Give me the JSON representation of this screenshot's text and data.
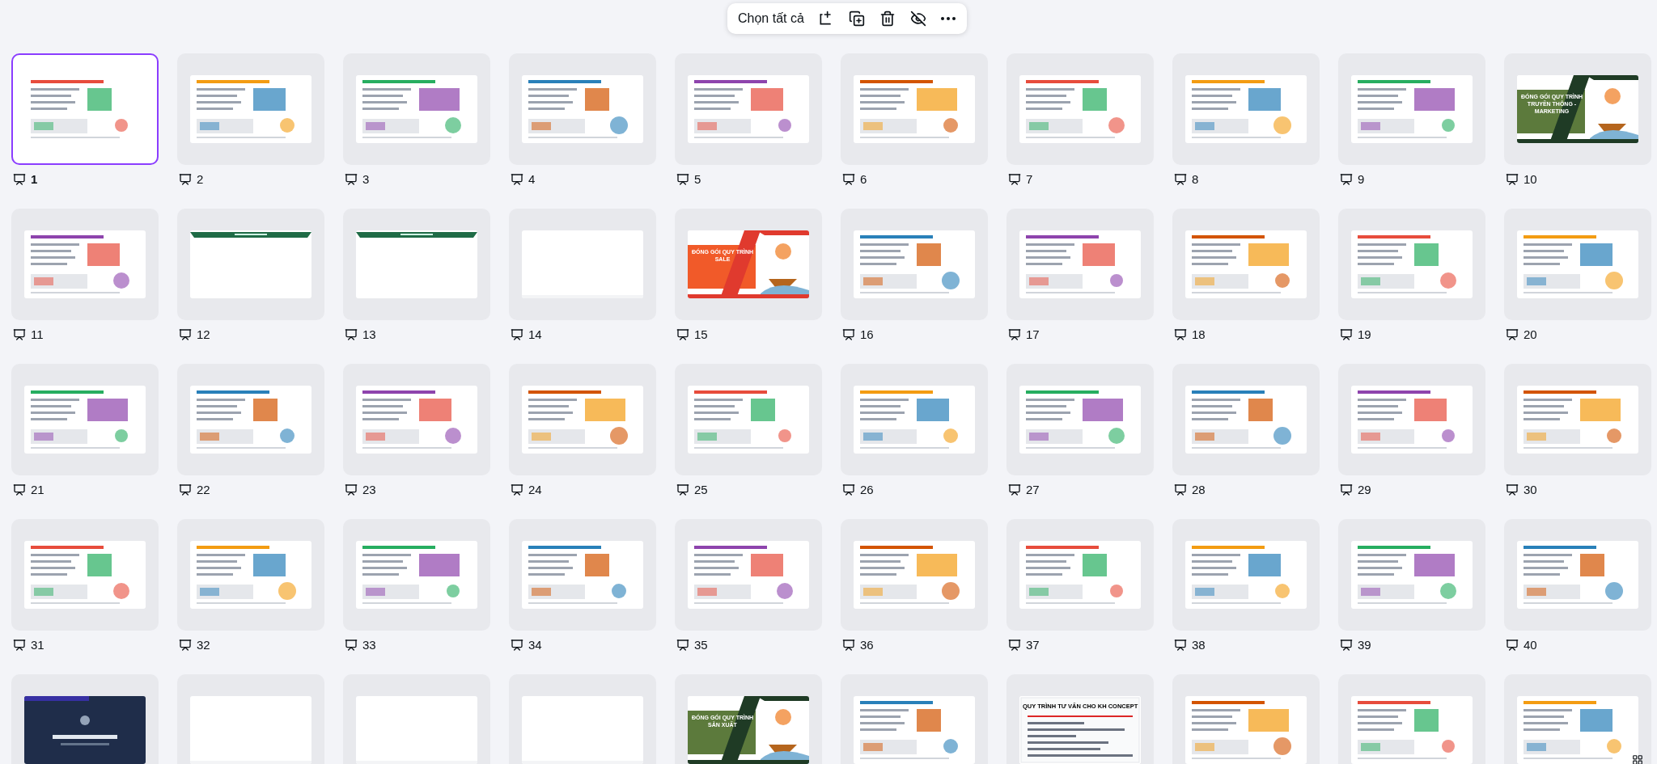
{
  "toolbar": {
    "select_all": "Chọn tất cả"
  },
  "slides": [
    {
      "number": "1",
      "selected": true,
      "kind": "doc"
    },
    {
      "number": "2",
      "selected": false,
      "kind": "doc"
    },
    {
      "number": "3",
      "selected": false,
      "kind": "doc"
    },
    {
      "number": "4",
      "selected": false,
      "kind": "doc"
    },
    {
      "number": "5",
      "selected": false,
      "kind": "doc"
    },
    {
      "number": "6",
      "selected": false,
      "kind": "doc"
    },
    {
      "number": "7",
      "selected": false,
      "kind": "doc"
    },
    {
      "number": "8",
      "selected": false,
      "kind": "doc"
    },
    {
      "number": "9",
      "selected": false,
      "kind": "doc"
    },
    {
      "number": "10",
      "selected": false,
      "kind": "green",
      "title": "ĐÓNG GÓI QUY TRÌNH TRUYỀN THÔNG - MARKETING"
    },
    {
      "number": "11",
      "selected": false,
      "kind": "doc"
    },
    {
      "number": "12",
      "selected": false,
      "kind": "banner"
    },
    {
      "number": "13",
      "selected": false,
      "kind": "banner"
    },
    {
      "number": "14",
      "selected": false,
      "kind": "blank"
    },
    {
      "number": "15",
      "selected": false,
      "kind": "orange",
      "title": "ĐÓNG GÓI QUY TRÌNH SALE"
    },
    {
      "number": "16",
      "selected": false,
      "kind": "doc"
    },
    {
      "number": "17",
      "selected": false,
      "kind": "doc"
    },
    {
      "number": "18",
      "selected": false,
      "kind": "doc"
    },
    {
      "number": "19",
      "selected": false,
      "kind": "doc"
    },
    {
      "number": "20",
      "selected": false,
      "kind": "doc"
    },
    {
      "number": "21",
      "selected": false,
      "kind": "doc"
    },
    {
      "number": "22",
      "selected": false,
      "kind": "doc"
    },
    {
      "number": "23",
      "selected": false,
      "kind": "doc"
    },
    {
      "number": "24",
      "selected": false,
      "kind": "doc"
    },
    {
      "number": "25",
      "selected": false,
      "kind": "doc"
    },
    {
      "number": "26",
      "selected": false,
      "kind": "doc"
    },
    {
      "number": "27",
      "selected": false,
      "kind": "doc"
    },
    {
      "number": "28",
      "selected": false,
      "kind": "doc"
    },
    {
      "number": "29",
      "selected": false,
      "kind": "doc"
    },
    {
      "number": "30",
      "selected": false,
      "kind": "doc"
    },
    {
      "number": "31",
      "selected": false,
      "kind": "doc"
    },
    {
      "number": "32",
      "selected": false,
      "kind": "doc"
    },
    {
      "number": "33",
      "selected": false,
      "kind": "doc"
    },
    {
      "number": "34",
      "selected": false,
      "kind": "doc"
    },
    {
      "number": "35",
      "selected": false,
      "kind": "doc"
    },
    {
      "number": "36",
      "selected": false,
      "kind": "doc"
    },
    {
      "number": "37",
      "selected": false,
      "kind": "doc"
    },
    {
      "number": "38",
      "selected": false,
      "kind": "doc"
    },
    {
      "number": "39",
      "selected": false,
      "kind": "doc"
    },
    {
      "number": "40",
      "selected": false,
      "kind": "doc"
    },
    {
      "selected": false,
      "kind": "dark"
    },
    {
      "selected": false,
      "kind": "blank"
    },
    {
      "selected": false,
      "kind": "blank"
    },
    {
      "selected": false,
      "kind": "blank"
    },
    {
      "selected": false,
      "kind": "green",
      "title": "ĐÓNG GÓI QUY TRÌNH SẢN XUẤT"
    },
    {
      "selected": false,
      "kind": "doc"
    },
    {
      "selected": false,
      "kind": "heading",
      "title": "QUY TRÌNH TƯ VẤN CHO KH CONCEPT"
    },
    {
      "selected": false,
      "kind": "doc"
    },
    {
      "selected": false,
      "kind": "doc"
    },
    {
      "selected": false,
      "kind": "doc"
    }
  ]
}
